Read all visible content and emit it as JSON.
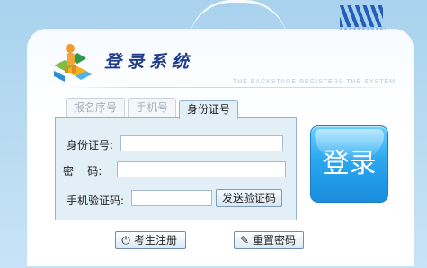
{
  "header": {
    "title": "登录系统",
    "subtitle": "THE BACKSTAGE REGISTERS THE SYSTEM"
  },
  "tabs": [
    {
      "label": "报名序号",
      "active": false
    },
    {
      "label": "手机号",
      "active": false
    },
    {
      "label": "身份证号",
      "active": true
    }
  ],
  "form": {
    "id_label": "身份证号:",
    "id_value": "",
    "password_label": "密    码:",
    "password_value": "",
    "sms_label": "手机验证码:",
    "sms_value": "",
    "sms_button": "发送验证码"
  },
  "login_button": "登录",
  "bottom": {
    "register_label": "考生注册",
    "reset_label": "重置密码"
  },
  "colors": {
    "accent_blue": "#2aa7ef",
    "background": "#a9d2ee",
    "panel": "#e3eff7"
  }
}
